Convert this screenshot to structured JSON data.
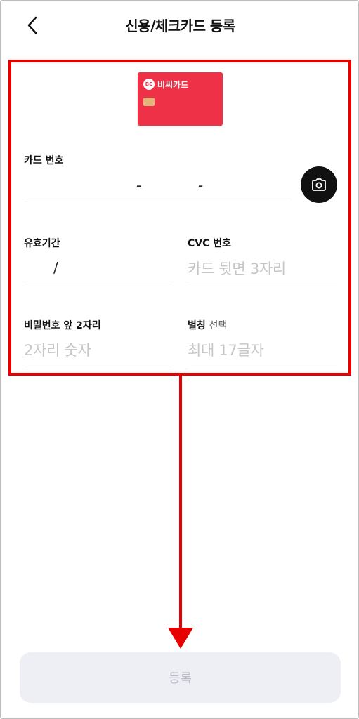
{
  "header": {
    "title": "신용/체크카드 등록",
    "back_icon": "chevron-left-icon"
  },
  "card_preview": {
    "brand_logo_text": "BC",
    "brand_name": "비씨카드",
    "color": "#ef3147"
  },
  "form": {
    "card_number": {
      "label": "카드 번호",
      "separator": "-",
      "camera_icon": "camera-icon"
    },
    "expiry": {
      "label": "유효기간",
      "separator": "/"
    },
    "cvc": {
      "label": "CVC 번호",
      "placeholder": "카드 뒷면 3자리"
    },
    "password": {
      "label": "비밀번호 앞 2자리",
      "placeholder": "2자리 숫자"
    },
    "nickname": {
      "label": "별칭",
      "label_optional": "선택",
      "placeholder": "최대 17글자"
    }
  },
  "footer": {
    "submit_label": "등록"
  },
  "annotation": {
    "color": "#e60000"
  }
}
